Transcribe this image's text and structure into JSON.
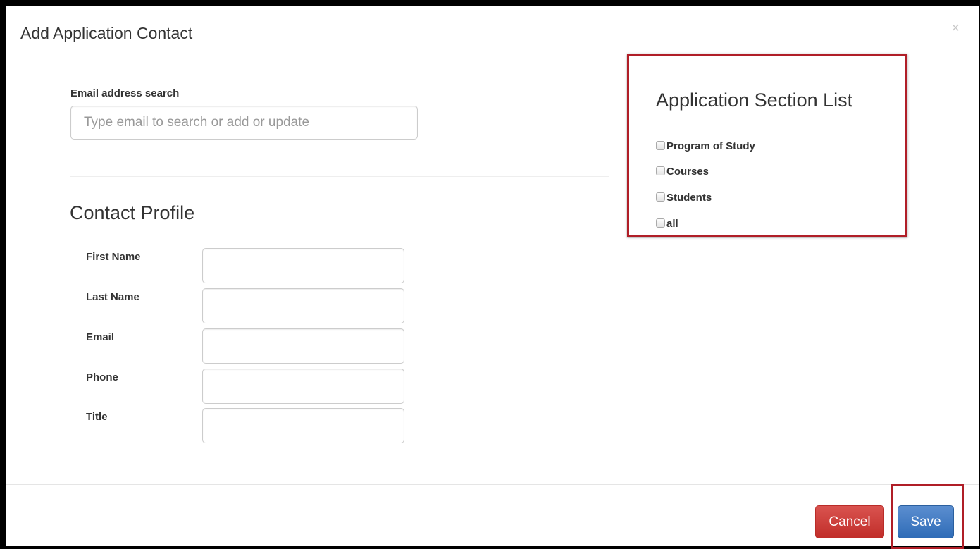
{
  "dialog": {
    "title": "Add Application Contact",
    "close_glyph": "×"
  },
  "email_search": {
    "label": "Email address search",
    "placeholder": "Type email to search or add or update",
    "value": ""
  },
  "contact_profile": {
    "title": "Contact Profile",
    "fields": [
      {
        "label": "First Name",
        "value": ""
      },
      {
        "label": "Last Name",
        "value": ""
      },
      {
        "label": "Email",
        "value": ""
      },
      {
        "label": "Phone",
        "value": ""
      },
      {
        "label": "Title",
        "value": ""
      }
    ]
  },
  "section_list": {
    "title": "Application Section List",
    "items": [
      {
        "label": "Program of Study",
        "checked": false
      },
      {
        "label": "Courses",
        "checked": false
      },
      {
        "label": "Students",
        "checked": false
      },
      {
        "label": "all",
        "checked": false
      }
    ]
  },
  "footer": {
    "cancel_label": "Cancel",
    "save_label": "Save"
  },
  "colors": {
    "highlight_border": "#b01e27",
    "cancel_button": "#c9302c",
    "save_button": "#3b73b9"
  }
}
